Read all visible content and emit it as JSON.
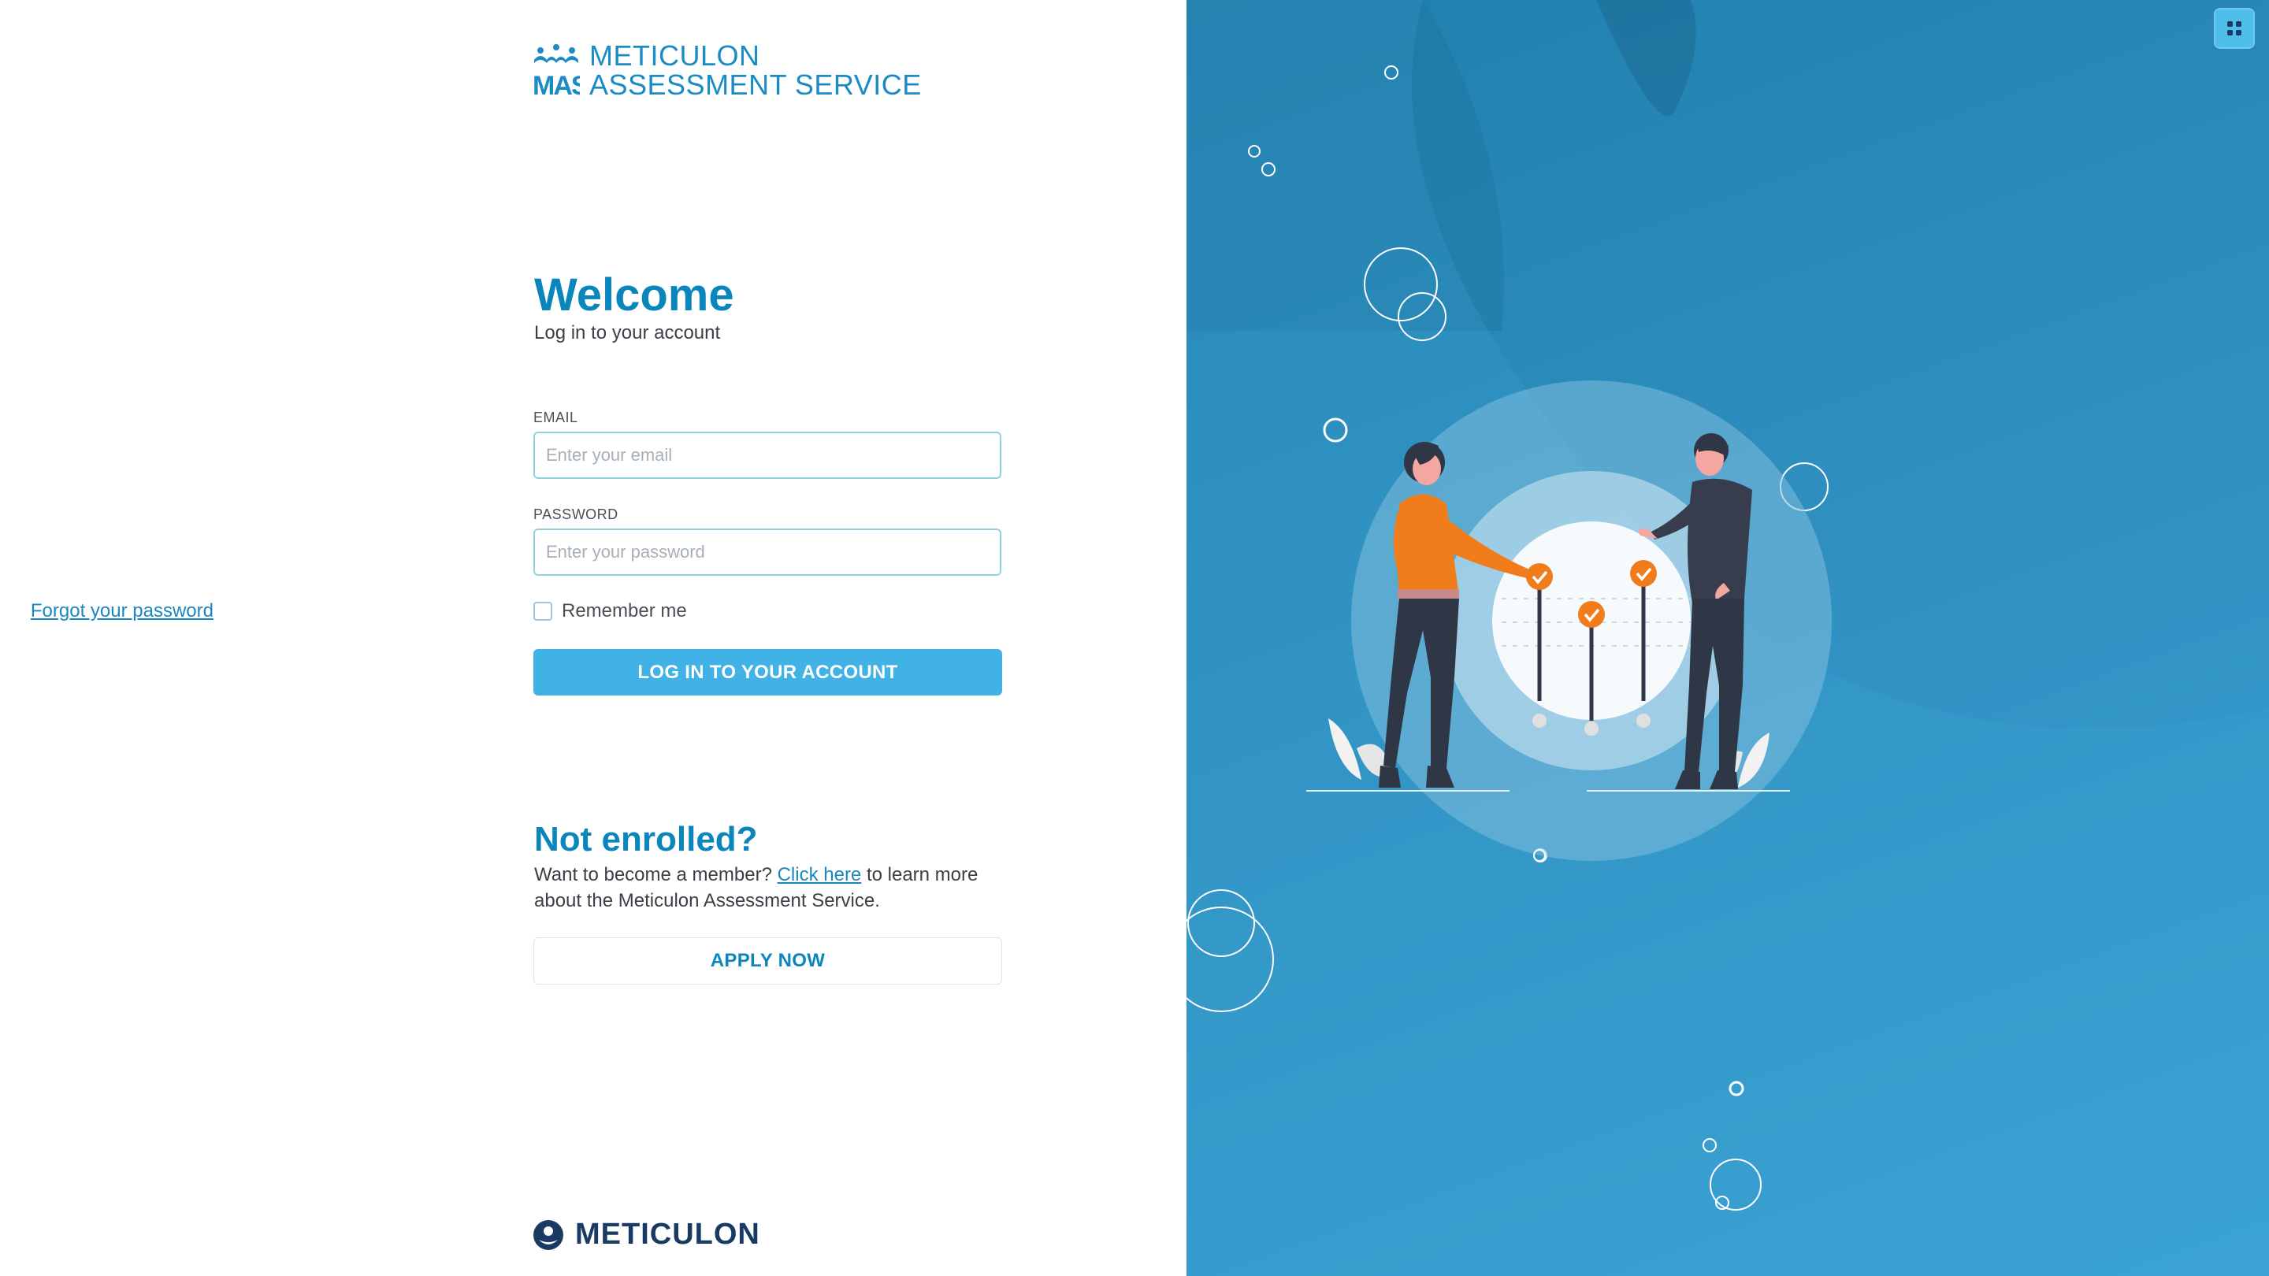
{
  "brand": {
    "line1": "METICULON",
    "line2": "ASSESSMENT SERVICE",
    "mark": "MAS"
  },
  "login": {
    "title": "Welcome",
    "subtitle": "Log in to your account",
    "email_label": "EMAIL",
    "email_placeholder": "Enter your email",
    "password_label": "PASSWORD",
    "password_placeholder": "Enter your password",
    "remember_label": "Remember me",
    "forgot_link": "Forgot your password",
    "submit_label": "LOG IN TO YOUR ACCOUNT"
  },
  "enroll": {
    "title": "Not enrolled?",
    "text_before": "Want to become a member? ",
    "link": "Click here",
    "text_after": " to learn more about the Meticulon Assessment Service.",
    "apply_label": "APPLY NOW"
  },
  "footer": {
    "logo_text": "METICULON"
  },
  "icons": {
    "apps": "apps-grid-icon",
    "brand": "mas-logo-icon",
    "footer": "meticulon-logo-icon"
  },
  "colors": {
    "accent": "#0b86bd",
    "button": "#41b2e6",
    "panel": "#2f8fc0",
    "figure_orange": "#f07c1b"
  }
}
